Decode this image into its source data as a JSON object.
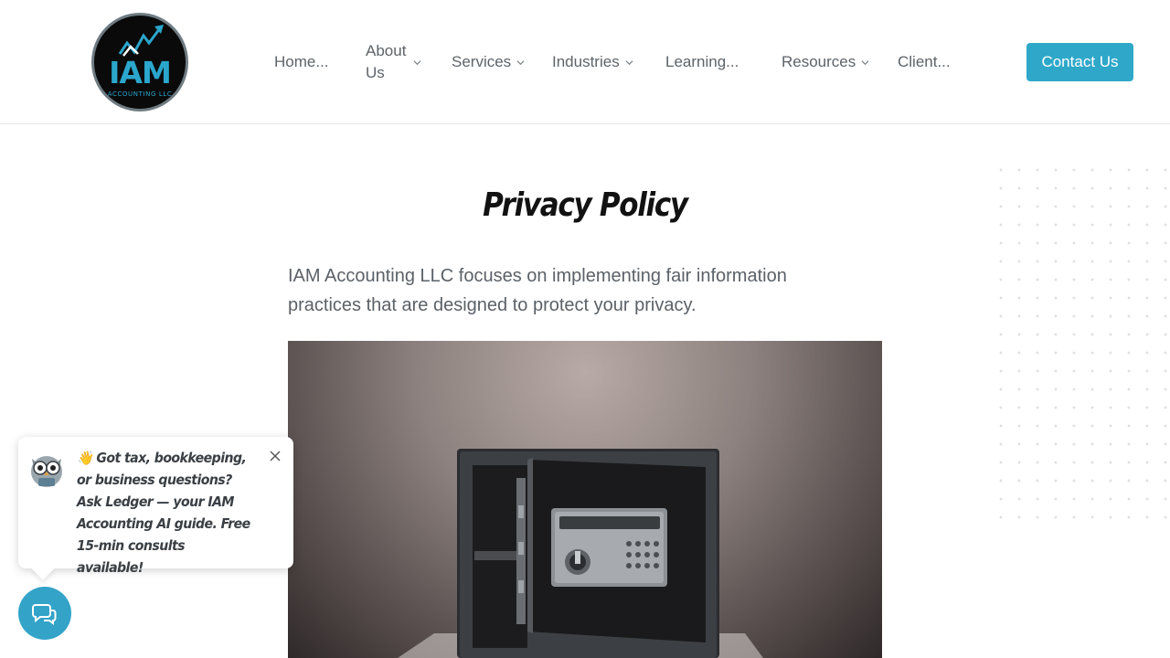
{
  "brand": {
    "logo_text": "IAM",
    "logo_subtext": "ACCOUNTING LLC",
    "accent_color": "#2ea7c9"
  },
  "nav": {
    "home": "Home...",
    "about_line1": "About",
    "about_line2": "Us",
    "services": "Services",
    "industries": "Industries",
    "learning": "Learning...",
    "resources": "Resources",
    "client": "Client...",
    "contact": "Contact Us"
  },
  "icons": {
    "dropdown": "chevron-down-icon",
    "close": "close-icon",
    "chat": "chat-bubbles-icon",
    "avatar": "owl-avatar-icon"
  },
  "main": {
    "title": "Privacy Policy",
    "intro": "IAM Accounting LLC focuses on implementing fair information practices that are designed to protect your privacy."
  },
  "chat": {
    "message": "👋 Got tax, bookkeeping, or business questions? Ask Ledger — your IAM Accounting AI guide. Free 15-min consults available!"
  }
}
